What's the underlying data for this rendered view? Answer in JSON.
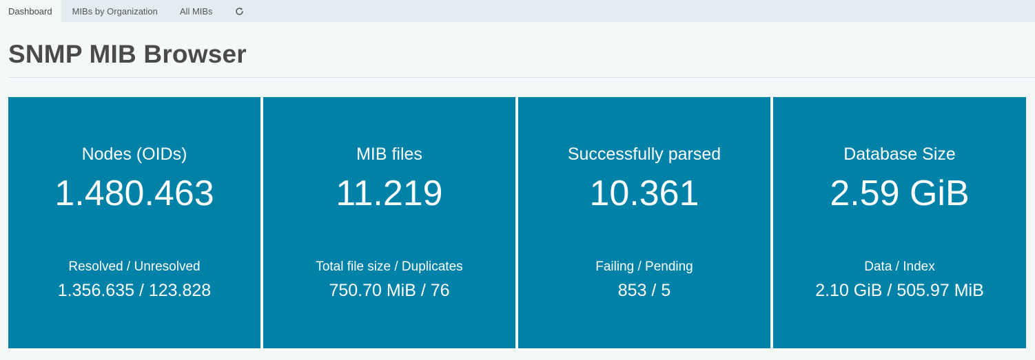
{
  "tabs": [
    {
      "label": "Dashboard",
      "active": true
    },
    {
      "label": "MIBs by Organization",
      "active": false
    },
    {
      "label": "All MIBs",
      "active": false
    }
  ],
  "refresh": {
    "icon": "refresh-icon"
  },
  "page": {
    "title": "SNMP MIB Browser"
  },
  "cards": [
    {
      "label": "Nodes (OIDs)",
      "value": "1.480.463",
      "sublabel": "Resolved / Unresolved",
      "subvalue": "1.356.635 / 123.828"
    },
    {
      "label": "MIB files",
      "value": "11.219",
      "sublabel": "Total file size / Duplicates",
      "subvalue": "750.70 MiB / 76"
    },
    {
      "label": "Successfully parsed",
      "value": "10.361",
      "sublabel": "Failing / Pending",
      "subvalue": "853 / 5"
    },
    {
      "label": "Database Size",
      "value": "2.59 GiB",
      "sublabel": "Data / Index",
      "subvalue": "2.10 GiB / 505.97 MiB"
    }
  ],
  "colors": {
    "card_bg": "#0082a8",
    "tabbar_bg": "#e3ecf0",
    "page_bg": "#f5f8f9"
  }
}
